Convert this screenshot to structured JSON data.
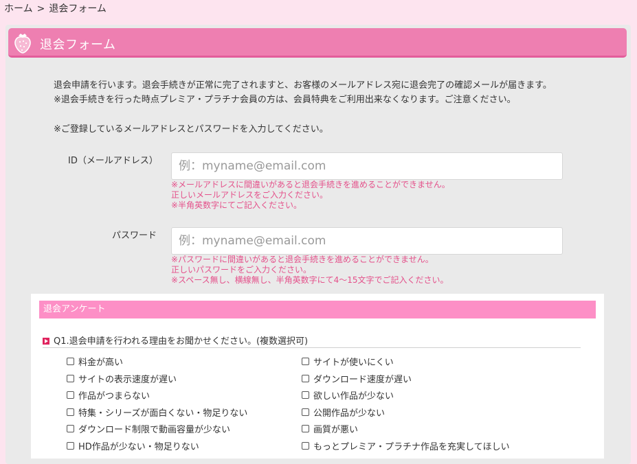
{
  "breadcrumb": {
    "home": "ホーム",
    "separator": ">",
    "current": "退会フォーム"
  },
  "header": {
    "title": "退会フォーム",
    "icon": "strawberry-icon",
    "colors": {
      "bar": "#ee7fb1",
      "page_bg": "#fde4ef"
    }
  },
  "intro": {
    "line1": "退会申請を行います。退会手続きが正常に完了されますと、お客様のメールアドレス宛に退会完了の確認メールが届きます。",
    "line2": "※退会手続きを行った時点プレミア・プラチナ会員の方は、会員特典をご利用出来なくなります。ご注意ください。",
    "line3": "※ご登録しているメールアドレスとパスワードを入力してください。"
  },
  "form": {
    "id_label": "ID（メールアドレス）",
    "id_placeholder": "例：myname@email.com",
    "id_value": "",
    "id_notes": [
      "※メールアドレスに間違いがあると退会手続きを進めることができません。",
      "正しいメールアドレスをご入力ください。",
      "※半角英数字にてご記入ください。"
    ],
    "password_label": "パスワード",
    "password_placeholder": "例：myname@email.com",
    "password_value": "",
    "password_notes": [
      "※パスワードに間違いがあると退会手続きを進めることができません。",
      "正しいパスワードをご入力ください。",
      "※スペース無し、横線無し、半角英数字にて4〜15文字でご記入ください。"
    ],
    "note_color": "#e4508a"
  },
  "survey": {
    "header": "退会アンケート",
    "header_color": "#fd8fc6",
    "q1": {
      "title": "Q1.退会申請を行われる理由をお聞かせください。(複数選択可)",
      "options_left": [
        "料金が高い",
        "サイトの表示速度が遅い",
        "作品がつまらない",
        "特集・シリーズが面白くない・物足りない",
        "ダウンロード制限で動画容量が少ない",
        "HD作品が少ない・物足りない"
      ],
      "options_right": [
        "サイトが使いにくい",
        "ダウンロード速度が遅い",
        "欲しい作品が少ない",
        "公開作品が少ない",
        "画質が悪い",
        "もっとプレミア・プラチナ作品を充実してほしい"
      ]
    }
  }
}
